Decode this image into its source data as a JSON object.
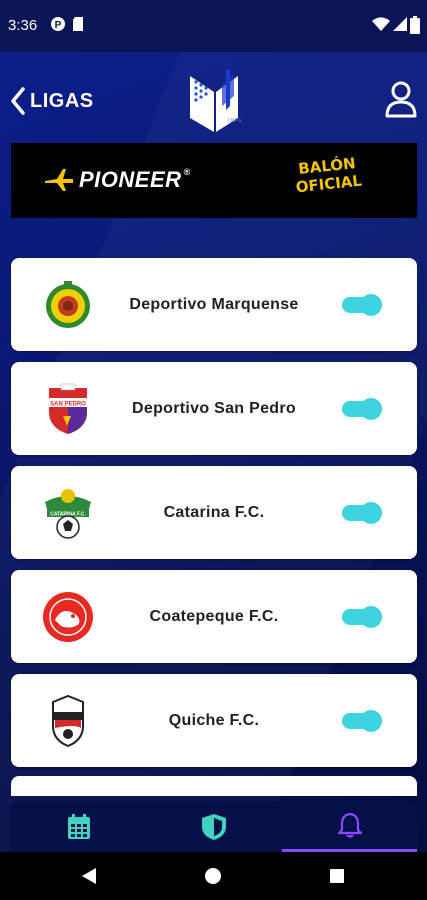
{
  "status_bar": {
    "time": "3:36"
  },
  "header": {
    "back_label": "LIGAS"
  },
  "sponsor": {
    "left_brand": "PIONEER",
    "left_brand_mark": "®",
    "right_line1": "BALÓN",
    "right_line2": "OFICIAL"
  },
  "teams": [
    {
      "name": "Deportivo Marquense",
      "enabled": true
    },
    {
      "name": "Deportivo San Pedro",
      "enabled": true
    },
    {
      "name": "Catarina F.C.",
      "enabled": true
    },
    {
      "name": "Coatepeque F.C.",
      "enabled": true
    },
    {
      "name": "Quiche F.C.",
      "enabled": true
    }
  ],
  "bottom_nav": {
    "items": [
      {
        "icon": "calendar-icon"
      },
      {
        "icon": "shield-icon"
      },
      {
        "icon": "bell-icon",
        "active": true
      }
    ]
  },
  "colors": {
    "accent": "#3fd3e0",
    "active_tab": "#8a4bff",
    "bg": "#0a1975"
  }
}
